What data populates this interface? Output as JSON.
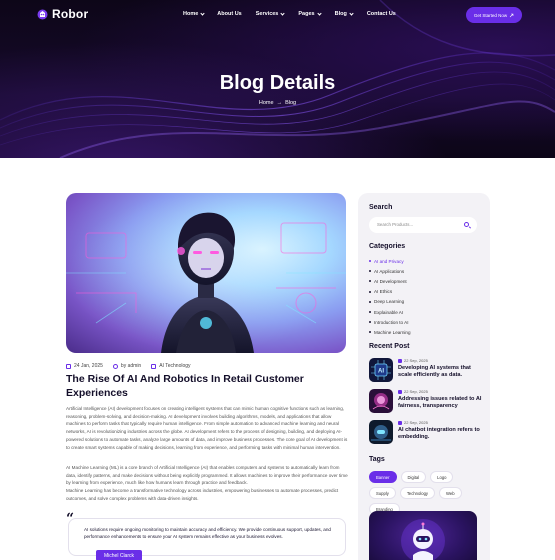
{
  "brand": {
    "name": "Robor",
    "accent": "#6a2ee8"
  },
  "nav": {
    "items": [
      {
        "label": "Home",
        "has_dropdown": true
      },
      {
        "label": "About Us",
        "has_dropdown": false
      },
      {
        "label": "Services",
        "has_dropdown": true
      },
      {
        "label": "Pages",
        "has_dropdown": true
      },
      {
        "label": "Blog",
        "has_dropdown": true
      },
      {
        "label": "Contact Us",
        "has_dropdown": false
      }
    ],
    "cta_label": "Get Started Now"
  },
  "hero": {
    "title": "Blog Details",
    "breadcrumb": {
      "home": "Home",
      "separator": "→",
      "current": "Blog"
    }
  },
  "post": {
    "date": "24 Jan, 2025",
    "author": "by admin",
    "category": "AI Technology",
    "title": "The Rise Of AI And Robotics In Retail Customer Experiences",
    "paragraph1": "Artificial Intelligence (AI) development focuses on creating intelligent systems that can mimic human cognitive functions such as learning, reasoning, problem-solving, and decision-making. AI development involves building algorithms, models, and applications that allow machines to perform tasks that typically require human intelligence. From simple automation to advanced machine learning and neural networks, AI is revolutionizing industries across the globe. AI development refers to the process of designing, building, and deploying AI-powered solutions to automate tasks, analyze large amounts of data, and improve business processes. The core goal of AI development is to create smart systems capable of making decisions, learning from experience, and performing tasks with minimal human intervention.",
    "paragraph2a": "AI Machine Learning (ML) is a core branch of Artificial Intelligence (AI) that enables computers and systems to automatically learn from data, identify patterns, and make decisions without being explicitly programmed. It allows machines to improve their performance over time by learning from experience, much like how humans learn through practice and feedback.",
    "paragraph2b": "Machine Learning has become a transformative technology across industries, empowering businesses to automate processes, predict outcomes, and solve complex problems with data-driven insights.",
    "quote": "AI solutions require ongoing monitoring to maintain accuracy and efficiency. We provide continuous support, updates, and performance enhancements to ensure your AI system remains effective as your business evolves.",
    "quote_author": "Michel Clarck"
  },
  "sidebar": {
    "search": {
      "heading": "Search",
      "placeholder": "Search Products..."
    },
    "categories": {
      "heading": "Categories",
      "items": [
        {
          "label": "AI and Privacy",
          "active": true
        },
        {
          "label": "AI Applications",
          "active": false
        },
        {
          "label": "AI Development",
          "active": false
        },
        {
          "label": "AI Ethics",
          "active": false
        },
        {
          "label": "Deep Learning",
          "active": false
        },
        {
          "label": "Explainable AI",
          "active": false
        },
        {
          "label": "Introduction to AI",
          "active": false
        },
        {
          "label": "Machine Learning",
          "active": false
        }
      ]
    },
    "recent": {
      "heading": "Recent Post",
      "items": [
        {
          "date": "22 Sep, 2025",
          "title": "Developing AI systems that scale efficiently as data."
        },
        {
          "date": "22 Sep, 2025",
          "title": "Addressing issues related to AI fairness, transparency"
        },
        {
          "date": "22 Sep, 2025",
          "title": "AI chatbot integration refers to embedding."
        }
      ]
    },
    "tags": {
      "heading": "Tags",
      "items": [
        {
          "label": "Banner",
          "active": true
        },
        {
          "label": "Digital",
          "active": false
        },
        {
          "label": "Logo",
          "active": false
        },
        {
          "label": "Supply",
          "active": false
        },
        {
          "label": "Technology",
          "active": false
        },
        {
          "label": "Web",
          "active": false
        },
        {
          "label": "Branding",
          "active": false
        }
      ]
    }
  }
}
